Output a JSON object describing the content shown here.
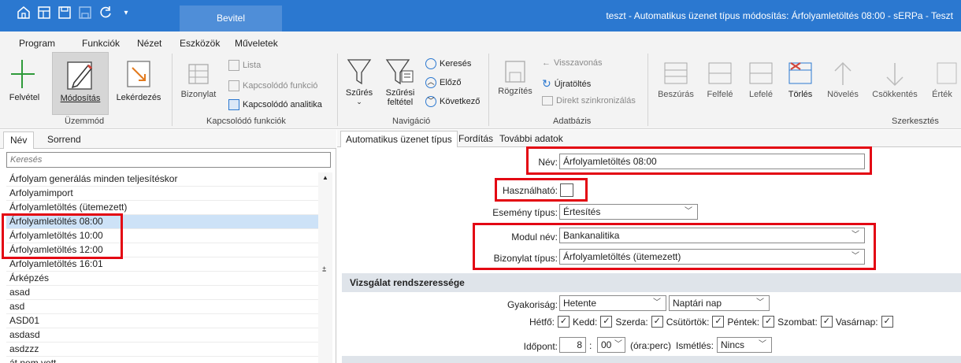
{
  "titlebar": {
    "context_tab": "Bevitel",
    "window_title": "teszt - Automatikus üzenet típus módosítás: Árfolyamletöltés 08:00 - sERPa - Teszt"
  },
  "menu": {
    "tabs": [
      "Program",
      "Funkciók",
      "Nézet",
      "Eszközök",
      "Műveletek"
    ]
  },
  "ribbon": {
    "mode": {
      "group_label": "Üzemmód",
      "new": "Felvétel",
      "modify": "Módosítás",
      "query": "Lekérdezés"
    },
    "related": {
      "group_label": "Kapcsolódó funkciók",
      "document": "Bizonylat",
      "list": "Lista",
      "related_function": "Kapcsolódó funkció",
      "related_analytics": "Kapcsolódó analitika"
    },
    "navigation": {
      "group_label": "Navigáció",
      "filter": "Szűrés",
      "filter_cond_1": "Szűrési",
      "filter_cond_2": "feltétel",
      "search": "Keresés",
      "previous": "Előző",
      "next": "Következő"
    },
    "database": {
      "group_label": "Adatbázis",
      "save": "Rögzítés",
      "undo": "Visszavonás",
      "reload": "Újratöltés",
      "direct_sync": "Direkt szinkronizálás"
    },
    "edit": {
      "group_label": "Szerkesztés",
      "insert": "Beszúrás",
      "up": "Felfelé",
      "down": "Lefelé",
      "delete": "Törlés",
      "increase": "Növelés",
      "decrease": "Csökkentés",
      "value": "Érték"
    }
  },
  "left_panel": {
    "tabs": [
      "Név",
      "Sorrend"
    ],
    "search_placeholder": "Keresés",
    "items": [
      "Árfolyam generálás minden teljesítéskor",
      "Arfolyamimport",
      "Árfolyamletöltés (ütemezett)",
      "Árfolyamletöltés 08:00",
      "Árfolyamletöltés 10:00",
      "Árfolyamletöltés 12:00",
      "Arfolyamletöltés 16:01",
      "Árképzés",
      "asad",
      "asd",
      "ASD01",
      "asdasd",
      "asdzzz",
      "át nem vett"
    ],
    "selected_index": 3
  },
  "right_panel": {
    "tabs": [
      "Automatikus üzenet típus",
      "Fordítás",
      "További adatok"
    ],
    "fields": {
      "name_label": "Név:",
      "name_value": "Árfolyamletöltés 08:00",
      "usable_label": "Használható:",
      "event_type_label": "Esemény típus:",
      "event_type_value": "Értesítés",
      "module_label": "Modul név:",
      "module_value": "Bankanalitika",
      "doc_type_label": "Bizonylat típus:",
      "doc_type_value": "Árfolyamletöltés (ütemezett)"
    },
    "section": {
      "title": "Vizsgálat rendszeressége",
      "frequency_label": "Gyakoriság:",
      "frequency_value": "Hetente",
      "calendar_value": "Naptári nap",
      "days": [
        {
          "label": "Hétfő:",
          "checked": true
        },
        {
          "label": "Kedd:",
          "checked": true
        },
        {
          "label": "Szerda:",
          "checked": true
        },
        {
          "label": "Csütörtök:",
          "checked": true
        },
        {
          "label": "Péntek:",
          "checked": true
        },
        {
          "label": "Szombat:",
          "checked": true
        },
        {
          "label": "Vasárnap:",
          "checked": true
        }
      ],
      "time_label": "Időpont:",
      "hour": "8",
      "colon": ":",
      "minute": "00",
      "time_unit": "(óra:perc)",
      "repeat_label": "Ismétlés:",
      "repeat_value": "Nincs"
    }
  },
  "colors": {
    "titlebar": "#2b78d0",
    "highlight": "#e30613",
    "selected_row": "#cde2f7"
  }
}
